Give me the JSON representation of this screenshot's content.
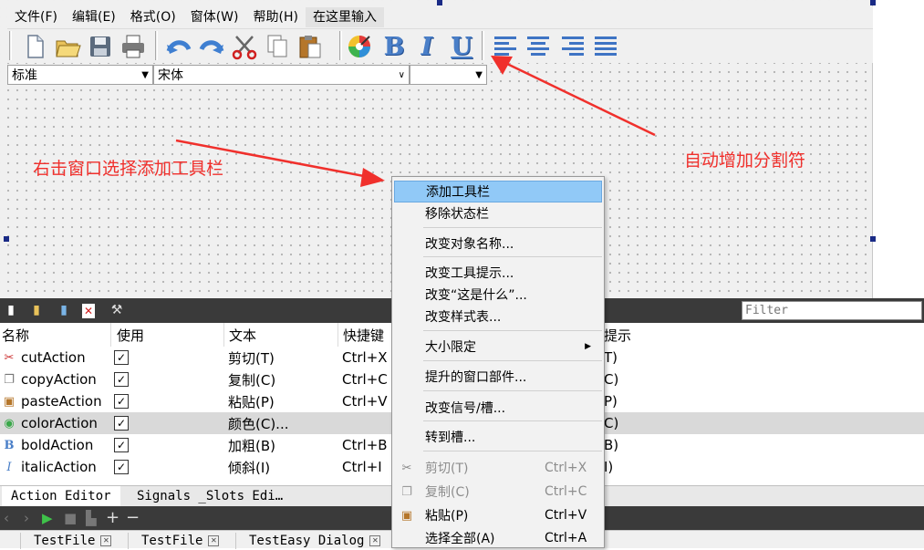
{
  "form": {
    "menubar": [
      "文件(F)",
      "编辑(E)",
      "格式(O)",
      "窗体(W)",
      "帮助(H)",
      "在这里输入"
    ],
    "toolbar_letters": {
      "bold": "B",
      "italic": "I",
      "underline": "U"
    },
    "combos": {
      "style": "标准",
      "font": "宋体",
      "size": ""
    }
  },
  "annotations": {
    "left": "右击窗口选择添加工具栏",
    "right": "自动增加分割符",
    "color": "#f0302c"
  },
  "action_editor": {
    "filter_placeholder": "Filter",
    "columns": [
      "名称",
      "使用",
      "文本",
      "快捷键",
      "提示"
    ],
    "rows": [
      {
        "icon": "scissors-icon",
        "name": "cutAction",
        "used": true,
        "text": "剪切(T)",
        "shortcut": "Ctrl+X",
        "tip": "T)"
      },
      {
        "icon": "copy-icon",
        "name": "copyAction",
        "used": true,
        "text": "复制(C)",
        "shortcut": "Ctrl+C",
        "tip": "C)"
      },
      {
        "icon": "paste-icon",
        "name": "pasteAction",
        "used": true,
        "text": "粘贴(P)",
        "shortcut": "Ctrl+V",
        "tip": "P)"
      },
      {
        "icon": "color-wheel-icon",
        "name": "colorAction",
        "used": true,
        "text": "颜色(C)...",
        "shortcut": "",
        "tip": "C)",
        "selected": true
      },
      {
        "icon": "bold-icon",
        "name": "boldAction",
        "used": true,
        "text": "加粗(B)",
        "shortcut": "Ctrl+B",
        "tip": "B)"
      },
      {
        "icon": "italic-icon",
        "name": "italicAction",
        "used": true,
        "text": "倾斜(I)",
        "shortcut": "Ctrl+I",
        "tip": "I)"
      }
    ]
  },
  "bottom_tabs": [
    "Action Editor",
    "Signals _Slots Edi…"
  ],
  "file_tabs": [
    "TestFile",
    "TestFile",
    "TestEasy Dialog"
  ],
  "context_menu": {
    "items": [
      {
        "label": "添加工具栏",
        "highlighted": true
      },
      {
        "label": "移除状态栏"
      },
      {
        "label": "改变对象名称..."
      },
      {
        "label": "改变工具提示..."
      },
      {
        "label": "改变“这是什么”..."
      },
      {
        "label": "改变样式表..."
      },
      {
        "label": "大小限定",
        "submenu": true
      },
      {
        "label": "提升的窗口部件..."
      },
      {
        "label": "改变信号/槽..."
      },
      {
        "label": "转到槽..."
      },
      {
        "label": "剪切(T)",
        "shortcut": "Ctrl+X",
        "disabled": true,
        "icon": "scissors-icon"
      },
      {
        "label": "复制(C)",
        "shortcut": "Ctrl+C",
        "disabled": true,
        "icon": "copy-icon"
      },
      {
        "label": "粘贴(P)",
        "shortcut": "Ctrl+V",
        "icon": "paste-icon"
      },
      {
        "label": "选择全部(A)",
        "shortcut": "Ctrl+A"
      }
    ]
  }
}
